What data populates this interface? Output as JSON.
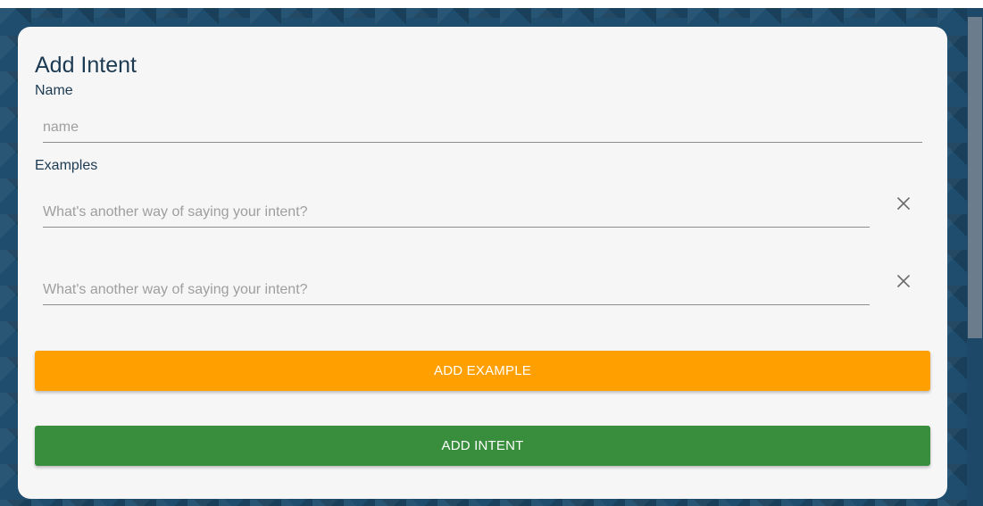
{
  "card": {
    "title": "Add Intent"
  },
  "name_section": {
    "label": "Name",
    "placeholder": "name",
    "value": ""
  },
  "examples_section": {
    "label": "Examples",
    "items": [
      {
        "placeholder": "What's another way of saying your intent?",
        "value": ""
      },
      {
        "placeholder": "What's another way of saying your intent?",
        "value": ""
      }
    ],
    "remove_icon": "close-icon"
  },
  "buttons": {
    "add_example": "ADD EXAMPLE",
    "add_intent": "ADD INTENT"
  },
  "colors": {
    "background": "#1f4d6e",
    "card": "#f6f6f6",
    "heading_text": "#1c3a52",
    "add_example": "#ffa000",
    "add_intent": "#388e3c"
  }
}
